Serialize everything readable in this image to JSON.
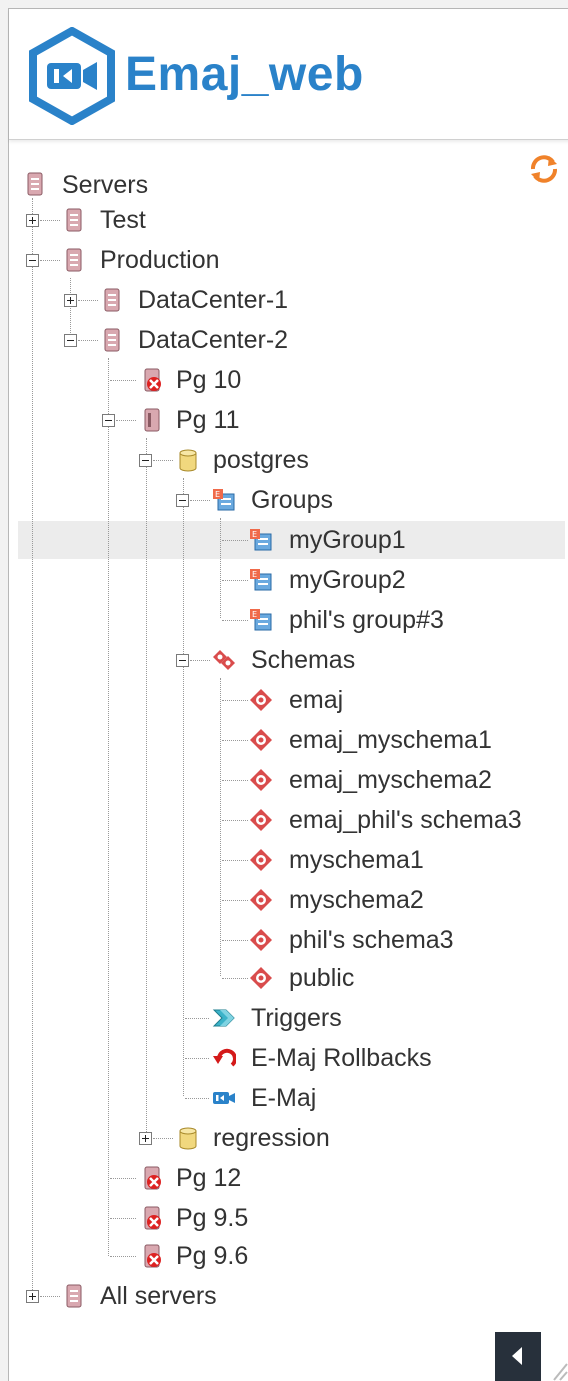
{
  "app": {
    "brand": "Emaj_web"
  },
  "colors": {
    "brand_blue": "#2a82c9",
    "refresh_orange": "#f0822a",
    "tree_text": "#333333",
    "selected_row_bg": "#ececec"
  },
  "icons": {
    "refresh": "refresh-icon",
    "collapse": "collapse-panel-icon"
  },
  "tree": {
    "root": "Servers",
    "test": "Test",
    "production": "Production",
    "dc1": "DataCenter-1",
    "dc2": "DataCenter-2",
    "pg10": "Pg 10",
    "pg11": "Pg 11",
    "postgres": "postgres",
    "groups": "Groups",
    "group_items": [
      "myGroup1",
      "myGroup2",
      "phil's group#3"
    ],
    "schemas": "Schemas",
    "schema_items": [
      "emaj",
      "emaj_myschema1",
      "emaj_myschema2",
      "emaj_phil's schema3",
      "myschema1",
      "myschema2",
      "phil's schema3",
      "public"
    ],
    "triggers": "Triggers",
    "rollbacks": "E-Maj Rollbacks",
    "emaj": "E-Maj",
    "regression": "regression",
    "pg12": "Pg 12",
    "pg95": "Pg 9.5",
    "pg96": "Pg 9.6",
    "all_servers": "All servers",
    "selected": "myGroup1"
  }
}
